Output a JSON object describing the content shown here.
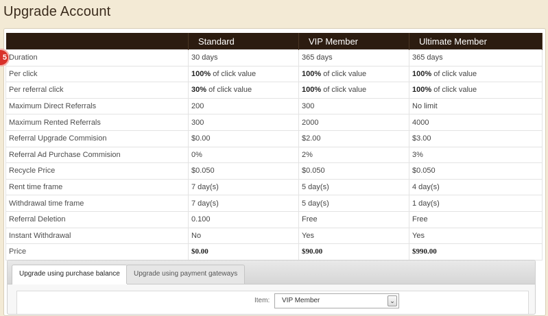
{
  "page": {
    "title": "Upgrade Account"
  },
  "badge": {
    "text": "5"
  },
  "table": {
    "headers": [
      "",
      "Standard",
      "VIP Member",
      "Ultimate Member"
    ],
    "rows": [
      [
        "Duration",
        "30 days",
        "365 days",
        "365 days"
      ],
      [
        "Per click",
        {
          "bold": "100%",
          "rest": " of click value"
        },
        {
          "bold": "100%",
          "rest": " of click value"
        },
        {
          "bold": "100%",
          "rest": " of click value"
        }
      ],
      [
        "Per referral click",
        {
          "bold": "30%",
          "rest": " of click value"
        },
        {
          "bold": "100%",
          "rest": " of click value"
        },
        {
          "bold": "100%",
          "rest": " of click value"
        }
      ],
      [
        "Maximum Direct Referrals",
        "200",
        "300",
        "No limit"
      ],
      [
        "Maximum Rented Referrals",
        "300",
        "2000",
        "4000"
      ],
      [
        "Referral Upgrade Commision",
        "$0.00",
        "$2.00",
        "$3.00"
      ],
      [
        "Referral Ad Purchase Commision",
        "0%",
        "2%",
        "3%"
      ],
      [
        "Recycle Price",
        "$0.050",
        "$0.050",
        "$0.050"
      ],
      [
        "Rent time frame",
        "7 day(s)",
        "5 day(s)",
        "4 day(s)"
      ],
      [
        "Withdrawal time frame",
        "7 day(s)",
        "5 day(s)",
        "1 day(s)"
      ],
      [
        "Referral Deletion",
        "0.100",
        "Free",
        "Free"
      ],
      [
        "Instant Withdrawal",
        "No",
        "Yes",
        "Yes"
      ],
      [
        "Price",
        "$0.00",
        "$90.00",
        "$990.00"
      ]
    ]
  },
  "tabs": [
    {
      "label": "Upgrade using purchase balance",
      "active": true
    },
    {
      "label": "Upgrade using payment gateways",
      "active": false
    }
  ],
  "form": {
    "item_label": "Item:",
    "item_value": "VIP Member",
    "arrow_glyph": "⌄"
  }
}
